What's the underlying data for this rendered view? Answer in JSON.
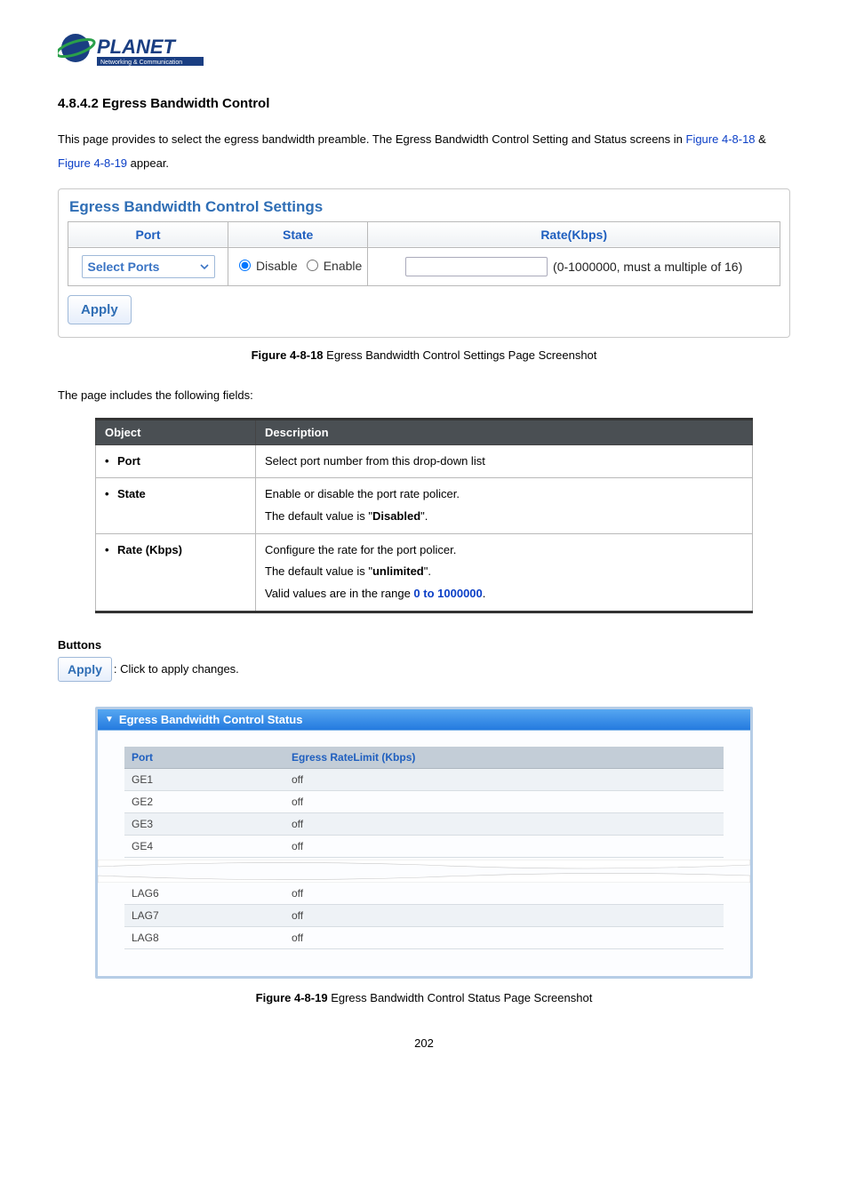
{
  "logo": {
    "brand": "PLANET",
    "tagline": "Networking & Communication"
  },
  "section_heading": "4.8.4.2 Egress Bandwidth Control",
  "intro_text_pre": "This page provides to select the egress bandwidth preamble. The Egress Bandwidth Control Setting and Status screens in ",
  "fig_link_1": "Figure 4-8-18",
  "intro_amp": " & ",
  "fig_link_2": "Figure 4-8-19",
  "intro_text_post": " appear.",
  "settings_panel": {
    "title": "Egress Bandwidth Control Settings",
    "headers": {
      "port": "Port",
      "state": "State",
      "rate": "Rate(Kbps)"
    },
    "port_select_label": "Select Ports",
    "state_disable": "Disable",
    "state_enable": "Enable",
    "rate_hint": "(0-1000000, must a multiple of 16)",
    "apply_label": "Apply"
  },
  "figure1_caption_num": "Figure 4-8-18",
  "figure1_caption_text": " Egress Bandwidth Control Settings Page Screenshot",
  "fields_intro": "The page includes the following fields:",
  "obj_table": {
    "headers": {
      "object": "Object",
      "description": "Description"
    },
    "rows": [
      {
        "obj": "Port",
        "desc_lines": [
          "Select port number from this drop-down list"
        ]
      },
      {
        "obj": "State",
        "desc_lines": [
          "Enable or disable the port rate policer.",
          "The default value is \"<b>Disabled</b>\"."
        ]
      },
      {
        "obj": "Rate (Kbps)",
        "desc_lines": [
          "Configure the rate for the port policer.",
          "The default value is \"<b>unlimited</b>\".",
          "Valid values are in the range <span class='link-style'><b>0 to 1000000</b></span>."
        ]
      }
    ]
  },
  "buttons_heading": "Buttons",
  "buttons_apply_label": "Apply",
  "buttons_apply_desc": ": Click to apply changes.",
  "status_panel": {
    "title": "Egress Bandwidth Control Status",
    "headers": {
      "port": "Port",
      "rate": "Egress RateLimit (Kbps)"
    },
    "rows_top": [
      {
        "port": "GE1",
        "rate": "off"
      },
      {
        "port": "GE2",
        "rate": "off"
      },
      {
        "port": "GE3",
        "rate": "off"
      },
      {
        "port": "GE4",
        "rate": "off"
      }
    ],
    "rows_bottom": [
      {
        "port": "LAG6",
        "rate": "off"
      },
      {
        "port": "LAG7",
        "rate": "off"
      },
      {
        "port": "LAG8",
        "rate": "off"
      }
    ]
  },
  "figure2_caption_num": "Figure 4-8-19",
  "figure2_caption_text": " Egress Bandwidth Control Status Page Screenshot",
  "page_number": "202"
}
